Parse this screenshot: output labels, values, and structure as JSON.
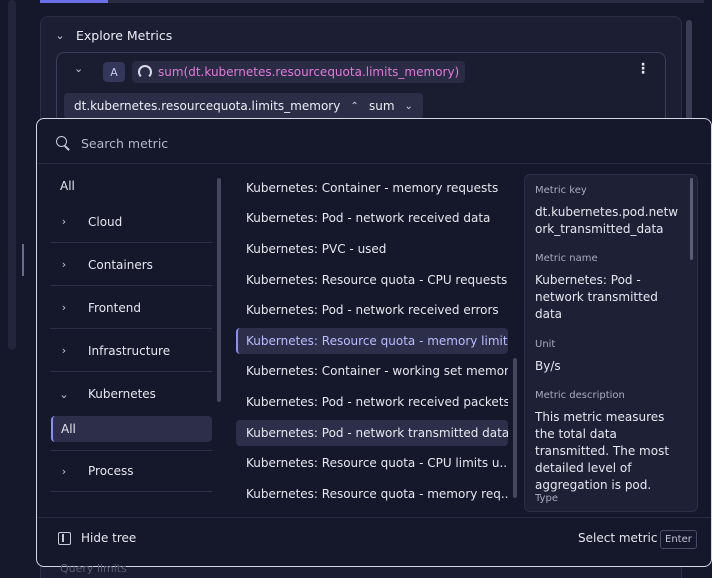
{
  "explore": {
    "title": "Explore Metrics",
    "query_letter": "A",
    "query_expression": "sum(dt.kubernetes.resourcequota.limits_memory)",
    "metric_chip": "dt.kubernetes.resourcequota.limits_memory",
    "agg_chip": "sum"
  },
  "search": {
    "placeholder": "Search metric"
  },
  "tree": {
    "all": "All",
    "items": [
      "Cloud",
      "Containers",
      "Frontend",
      "Infrastructure",
      "Kubernetes",
      "Process"
    ],
    "expanded": "Kubernetes",
    "sub_selected": "All"
  },
  "metrics": [
    "Kubernetes: Container - memory requests",
    "Kubernetes: Pod - network received data",
    "Kubernetes: PVC - used",
    "Kubernetes: Resource quota - CPU requests",
    "Kubernetes: Pod - network received errors",
    "Kubernetes: Resource quota - memory limits",
    "Kubernetes: Container - working set memory",
    "Kubernetes: Pod - network received packets",
    "Kubernetes: Pod - network transmitted data",
    "Kubernetes: Resource quota - CPU limits u...",
    "Kubernetes: Resource quota - memory req..."
  ],
  "details": {
    "key_label": "Metric key",
    "key_value": "dt.kubernetes.pod.network_transmitted_data",
    "name_label": "Metric name",
    "name_value": "Kubernetes: Pod - network transmitted data",
    "unit_label": "Unit",
    "unit_value": "By/s",
    "desc_label": "Metric description",
    "desc_value": "This metric measures the total data transmitted. The most detailed level of aggregation is pod.",
    "type_label": "Type"
  },
  "footer": {
    "hide_tree": "Hide tree",
    "select_metric": "Select metric",
    "enter": "Enter"
  },
  "background": {
    "partial_text": "Query limits"
  }
}
